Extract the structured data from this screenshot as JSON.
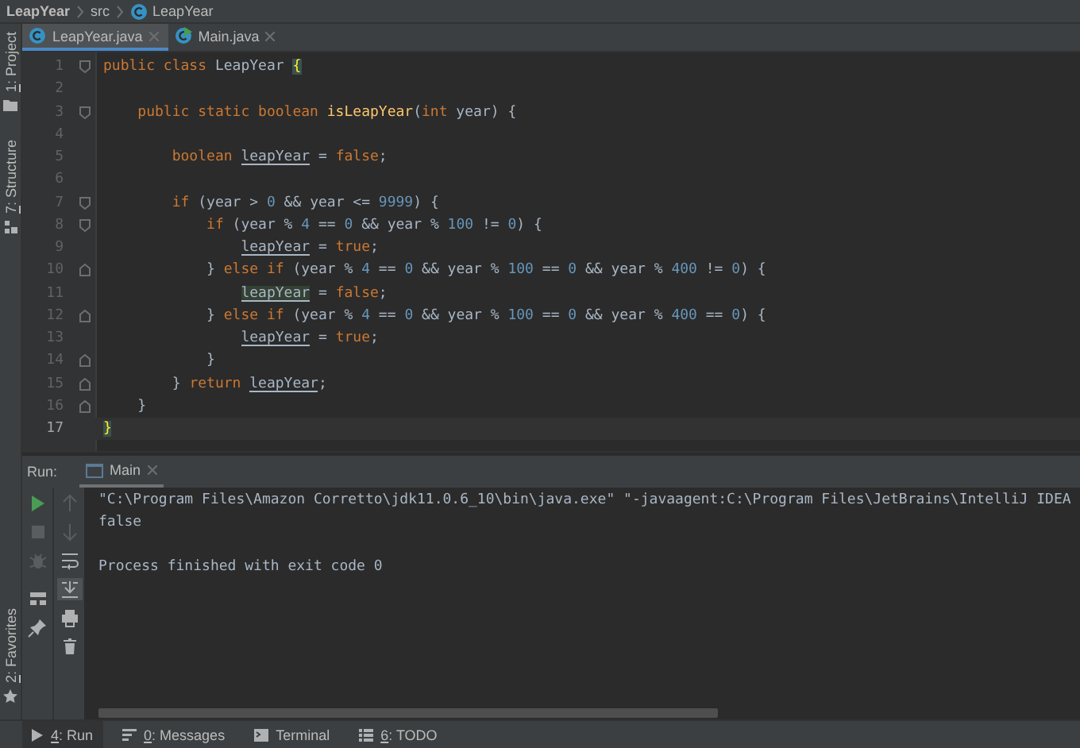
{
  "breadcrumbs": [
    {
      "label": "LeapYear",
      "kind": "project"
    },
    {
      "label": "src",
      "kind": "folder"
    },
    {
      "label": "LeapYear",
      "kind": "class"
    }
  ],
  "left_strip": [
    {
      "label": "1: Project",
      "kind": "project"
    },
    {
      "label": "7: Structure",
      "kind": "structure"
    },
    {
      "label": "2: Favorites",
      "kind": "favorites"
    }
  ],
  "editor_tabs": [
    {
      "label": "LeapYear.java",
      "kind": "class",
      "selected": true
    },
    {
      "label": "Main.java",
      "kind": "runnable-class",
      "selected": false
    }
  ],
  "editor": {
    "lines": [
      {
        "number": "1",
        "current": false,
        "fold_start": true,
        "fold_end": false,
        "tokens": [
          {
            "kind": "kw",
            "text": "public class "
          },
          {
            "kind": "plain",
            "text": "LeapYear "
          },
          {
            "kind": "brace",
            "text": "{"
          }
        ]
      },
      {
        "number": "2",
        "current": false,
        "fold_start": false,
        "fold_end": false
      },
      {
        "number": "3",
        "current": false,
        "fold_start": true,
        "fold_end": false,
        "tokens": [
          {
            "kind": "kw",
            "text": "    public static boolean "
          },
          {
            "kind": "method",
            "text": "isLeapYear"
          },
          {
            "kind": "plain",
            "text": "("
          },
          {
            "kind": "kw",
            "text": "int"
          },
          {
            "kind": "plain",
            "text": " year) {"
          }
        ]
      },
      {
        "number": "4",
        "current": false,
        "fold_start": false,
        "fold_end": false
      },
      {
        "number": "5",
        "current": false,
        "fold_start": false,
        "fold_end": false,
        "tokens": [
          {
            "kind": "kw",
            "text": "        boolean "
          },
          {
            "kind": "var",
            "text": "leapYear"
          },
          {
            "kind": "plain",
            "text": " = "
          },
          {
            "kind": "kw",
            "text": "false"
          },
          {
            "kind": "plain",
            "text": ";"
          }
        ]
      },
      {
        "number": "6",
        "current": false,
        "fold_start": false,
        "fold_end": false
      },
      {
        "number": "7",
        "current": false,
        "fold_start": true,
        "fold_end": false,
        "tokens": [
          {
            "kind": "kw",
            "text": "        if "
          },
          {
            "kind": "plain",
            "text": "(year > "
          },
          {
            "kind": "num",
            "text": "0"
          },
          {
            "kind": "plain",
            "text": " && year <= "
          },
          {
            "kind": "num",
            "text": "9999"
          },
          {
            "kind": "plain",
            "text": ") {"
          }
        ]
      },
      {
        "number": "8",
        "current": false,
        "fold_start": true,
        "fold_end": false,
        "tokens": [
          {
            "kind": "kw",
            "text": "            if "
          },
          {
            "kind": "plain",
            "text": "(year % "
          },
          {
            "kind": "num",
            "text": "4"
          },
          {
            "kind": "plain",
            "text": " == "
          },
          {
            "kind": "num",
            "text": "0"
          },
          {
            "kind": "plain",
            "text": " && year % "
          },
          {
            "kind": "num",
            "text": "100"
          },
          {
            "kind": "plain",
            "text": " != "
          },
          {
            "kind": "num",
            "text": "0"
          },
          {
            "kind": "plain",
            "text": ") {"
          }
        ]
      },
      {
        "number": "9",
        "current": false,
        "fold_start": false,
        "fold_end": false,
        "tokens": [
          {
            "kind": "var",
            "text": "                leapYear"
          },
          {
            "kind": "plain",
            "text": " = "
          },
          {
            "kind": "kw",
            "text": "true"
          },
          {
            "kind": "plain",
            "text": ";"
          }
        ]
      },
      {
        "number": "10",
        "current": false,
        "fold_start": false,
        "fold_end": true,
        "tokens": [
          {
            "kind": "plain",
            "text": "            } "
          },
          {
            "kind": "kw",
            "text": "else if "
          },
          {
            "kind": "plain",
            "text": "(year % "
          },
          {
            "kind": "num",
            "text": "4"
          },
          {
            "kind": "plain",
            "text": " == "
          },
          {
            "kind": "num",
            "text": "0"
          },
          {
            "kind": "plain",
            "text": " && year % "
          },
          {
            "kind": "num",
            "text": "100"
          },
          {
            "kind": "plain",
            "text": " == "
          },
          {
            "kind": "num",
            "text": "0"
          },
          {
            "kind": "plain",
            "text": " && year % "
          },
          {
            "kind": "num",
            "text": "400"
          },
          {
            "kind": "plain",
            "text": " != "
          },
          {
            "kind": "num",
            "text": "0"
          },
          {
            "kind": "plain",
            "text": ") {"
          }
        ]
      },
      {
        "number": "11",
        "current": false,
        "fold_start": false,
        "fold_end": false,
        "tokens": [
          {
            "kind": "var-highlight",
            "text": "                leapYear"
          },
          {
            "kind": "plain",
            "text": " = "
          },
          {
            "kind": "kw",
            "text": "false"
          },
          {
            "kind": "plain",
            "text": ";"
          }
        ]
      },
      {
        "number": "12",
        "current": false,
        "fold_start": false,
        "fold_end": true,
        "tokens": [
          {
            "kind": "plain",
            "text": "            } "
          },
          {
            "kind": "kw",
            "text": "else if "
          },
          {
            "kind": "plain",
            "text": "(year % "
          },
          {
            "kind": "num",
            "text": "4"
          },
          {
            "kind": "plain",
            "text": " == "
          },
          {
            "kind": "num",
            "text": "0"
          },
          {
            "kind": "plain",
            "text": " && year % "
          },
          {
            "kind": "num",
            "text": "100"
          },
          {
            "kind": "plain",
            "text": " == "
          },
          {
            "kind": "num",
            "text": "0"
          },
          {
            "kind": "plain",
            "text": " && year % "
          },
          {
            "kind": "num",
            "text": "400"
          },
          {
            "kind": "plain",
            "text": " == "
          },
          {
            "kind": "num",
            "text": "0"
          },
          {
            "kind": "plain",
            "text": ") {"
          }
        ]
      },
      {
        "number": "13",
        "current": false,
        "fold_start": false,
        "fold_end": false,
        "tokens": [
          {
            "kind": "var",
            "text": "                leapYear"
          },
          {
            "kind": "plain",
            "text": " = "
          },
          {
            "kind": "kw",
            "text": "true"
          },
          {
            "kind": "plain",
            "text": ";"
          }
        ]
      },
      {
        "number": "14",
        "current": false,
        "fold_start": false,
        "fold_end": true,
        "tokens": [
          {
            "kind": "plain",
            "text": "            }"
          }
        ]
      },
      {
        "number": "15",
        "current": false,
        "fold_start": false,
        "fold_end": true,
        "tokens": [
          {
            "kind": "plain",
            "text": "        } "
          },
          {
            "kind": "kw",
            "text": "return "
          },
          {
            "kind": "var",
            "text": "leapYear"
          },
          {
            "kind": "plain",
            "text": ";"
          }
        ]
      },
      {
        "number": "16",
        "current": false,
        "fold_start": false,
        "fold_end": true,
        "tokens": [
          {
            "kind": "plain",
            "text": "    }"
          }
        ]
      },
      {
        "number": "17",
        "current": true,
        "fold_start": false,
        "fold_end": false,
        "tokens": [
          {
            "kind": "brace",
            "text": "}"
          }
        ]
      }
    ]
  },
  "run_panel": {
    "label": "Run:",
    "tabs": [
      {
        "label": "Main",
        "selected": true
      }
    ],
    "tools_left": [
      {
        "kind": "rerun",
        "disabled": false
      },
      {
        "kind": "stop",
        "disabled": true
      },
      {
        "kind": "debug",
        "disabled": true
      },
      {
        "kind": "layout",
        "disabled": false
      },
      {
        "kind": "pin",
        "disabled": false
      }
    ],
    "tools_right": [
      {
        "kind": "up",
        "disabled": true,
        "on": false
      },
      {
        "kind": "down",
        "disabled": true,
        "on": false
      },
      {
        "kind": "wrap",
        "disabled": false,
        "on": false
      },
      {
        "kind": "scroll-end",
        "disabled": false,
        "on": true
      },
      {
        "kind": "print",
        "disabled": false,
        "on": false
      },
      {
        "kind": "trash",
        "disabled": false,
        "on": false
      }
    ],
    "console": [
      {
        "kind": "command",
        "text": "\"C:\\Program Files\\Amazon Corretto\\jdk11.0.6_10\\bin\\java.exe\" \"-javaagent:C:\\Program Files\\JetBrains\\IntelliJ IDEA"
      },
      {
        "kind": "output",
        "text": "false"
      },
      {
        "kind": "exit",
        "text": "Process finished with exit code 0"
      }
    ]
  },
  "status_bar": [
    {
      "label": "4: Run",
      "kind": "run",
      "mnemonic": true,
      "selected": true
    },
    {
      "label": "0: Messages",
      "kind": "messages",
      "mnemonic": true,
      "selected": false
    },
    {
      "label": "Terminal",
      "kind": "terminal",
      "mnemonic": false,
      "selected": false
    },
    {
      "label": "6: TODO",
      "kind": "todo",
      "mnemonic": true,
      "selected": false
    }
  ]
}
